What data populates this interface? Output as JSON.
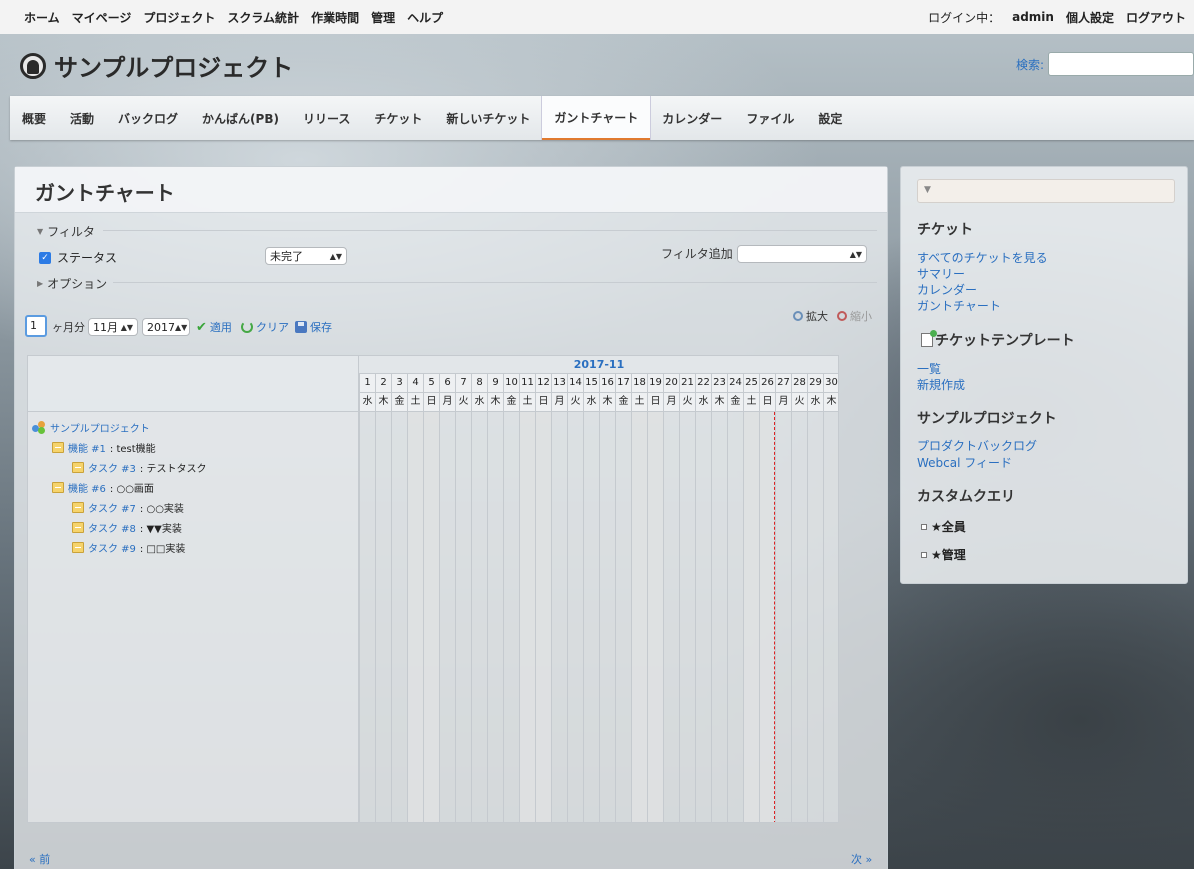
{
  "top_menu": {
    "left": [
      "ホーム",
      "マイページ",
      "プロジェクト",
      "スクラム統計",
      "作業時間",
      "管理",
      "ヘルプ"
    ],
    "logged_as_label": "ログイン中：",
    "user": "admin",
    "my_account": "個人設定",
    "logout": "ログアウト"
  },
  "header": {
    "project_name": "サンプルプロジェクト",
    "search_label": "検索:",
    "search_value": ""
  },
  "main_menu": {
    "tabs": [
      "概要",
      "活動",
      "バックログ",
      "かんばん(PB)",
      "リリース",
      "チケット",
      "新しいチケット",
      "ガントチャート",
      "カレンダー",
      "ファイル",
      "設定"
    ],
    "selected": "ガントチャート"
  },
  "content": {
    "title": "ガントチャート",
    "filter_legend": "フィルタ",
    "status_label": "ステータス",
    "status_value": "未完了",
    "add_filter_label": "フィルタ追加",
    "add_filter_value": "",
    "options_legend": "オプション",
    "months_value": "1",
    "months_label": "ヶ月分",
    "month_select": "11月",
    "year_select": "2017",
    "apply": "適用",
    "clear": "クリア",
    "save": "保存",
    "zoom_in": "拡大",
    "zoom_out": "縮小",
    "prev": "« 前",
    "next": "次 »"
  },
  "gantt": {
    "month_label": "2017-11",
    "days": [
      "1",
      "2",
      "3",
      "4",
      "5",
      "6",
      "7",
      "8",
      "9",
      "10",
      "11",
      "12",
      "13",
      "14",
      "15",
      "16",
      "17",
      "18",
      "19",
      "20",
      "21",
      "22",
      "23",
      "24",
      "25",
      "26",
      "27",
      "28",
      "29",
      "30"
    ],
    "weekdays": [
      "水",
      "木",
      "金",
      "土",
      "日",
      "月",
      "火",
      "水",
      "木",
      "金",
      "土",
      "日",
      "月",
      "火",
      "水",
      "木",
      "金",
      "土",
      "日",
      "月",
      "火",
      "水",
      "木",
      "金",
      "土",
      "日",
      "月",
      "火",
      "水",
      "木"
    ],
    "today_day": 27,
    "subjects": [
      {
        "link": "サンプルプロジェクト",
        "text": "",
        "type": "project",
        "level": 0
      },
      {
        "link": "機能 #1",
        "text": ": test機能",
        "type": "issue",
        "level": 1
      },
      {
        "link": "タスク #3",
        "text": ": テストタスク",
        "type": "issue",
        "level": 2
      },
      {
        "link": "機能 #6",
        "text": ": ○○画面",
        "type": "issue",
        "level": 1
      },
      {
        "link": "タスク #7",
        "text": ": ○○実装",
        "type": "issue",
        "level": 2
      },
      {
        "link": "タスク #8",
        "text": ": ▼▼実装",
        "type": "issue",
        "level": 2
      },
      {
        "link": "タスク #9",
        "text": ": □□実装",
        "type": "issue",
        "level": 2
      }
    ]
  },
  "sidebar": {
    "tickets_heading": "チケット",
    "ticket_links": [
      "すべてのチケットを見る",
      "サマリー",
      "カレンダー",
      "ガントチャート"
    ],
    "templates_heading": "チケットテンプレート",
    "template_links": [
      "一覧",
      "新規作成"
    ],
    "project_heading": "サンプルプロジェクト",
    "project_links": [
      "プロダクトバックログ",
      "Webcal フィード"
    ],
    "custom_query_heading": "カスタムクエリ",
    "custom_queries": [
      "★全員",
      "★管理"
    ]
  },
  "colors": {
    "link": "#2a6fc0",
    "selected_tab_underline": "#e07a2f",
    "today_line": "#dd2222",
    "checkbox": "#2c7be5"
  }
}
